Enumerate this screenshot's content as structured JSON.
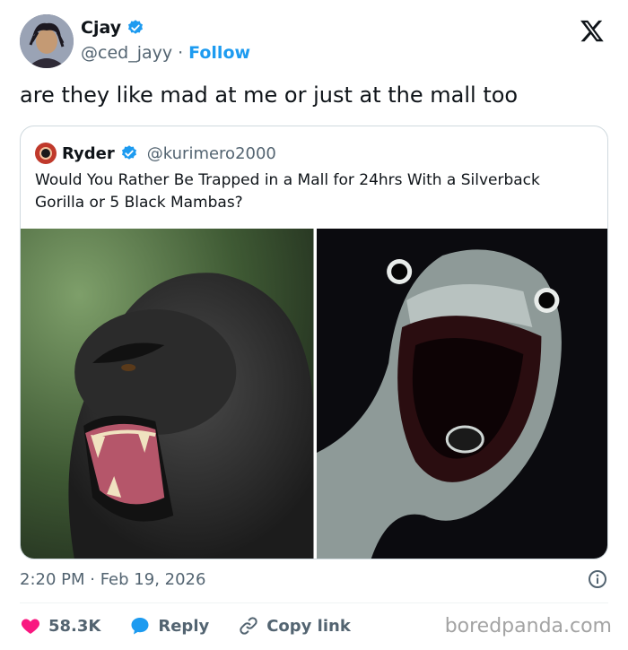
{
  "author": {
    "display_name": "Cjay",
    "handle": "@ced_jayy",
    "separator": "·",
    "follow_label": "Follow",
    "verified": true
  },
  "tweet": {
    "text": "are they like mad at me or just at the mall too",
    "timestamp": "2:20 PM · Feb 19, 2026"
  },
  "quoted_tweet": {
    "display_name": "Ryder",
    "handle": "@kurimero2000",
    "verified": true,
    "text": "Would You Rather Be Trapped in a Mall for 24hrs With a Silverback Gorilla or 5 Black Mambas?",
    "media": [
      "gorilla-photo",
      "black-mamba-photo"
    ]
  },
  "actions": {
    "like_count": "58.3K",
    "reply_label": "Reply",
    "copy_label": "Copy link"
  },
  "watermark": "boredpanda.com",
  "colors": {
    "accent": "#1d9bf0",
    "like": "#f91880",
    "text": "#0f1419",
    "muted": "#536471"
  }
}
